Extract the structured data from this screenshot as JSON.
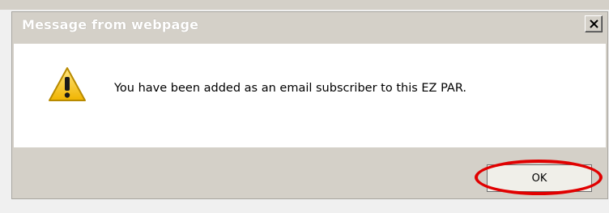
{
  "dialog": {
    "title": "Message from webpage",
    "message": "You have been added as an email subscriber to this EZ PAR.",
    "close_icon": "close-icon",
    "warning_icon": "warning-icon",
    "ok_label": "OK"
  },
  "colors": {
    "title_text": "#ffffff",
    "dialog_bg": "#d4d0c8",
    "content_bg": "#ffffff",
    "highlight": "#e10000",
    "warning_yellow": "#f7c81e"
  }
}
